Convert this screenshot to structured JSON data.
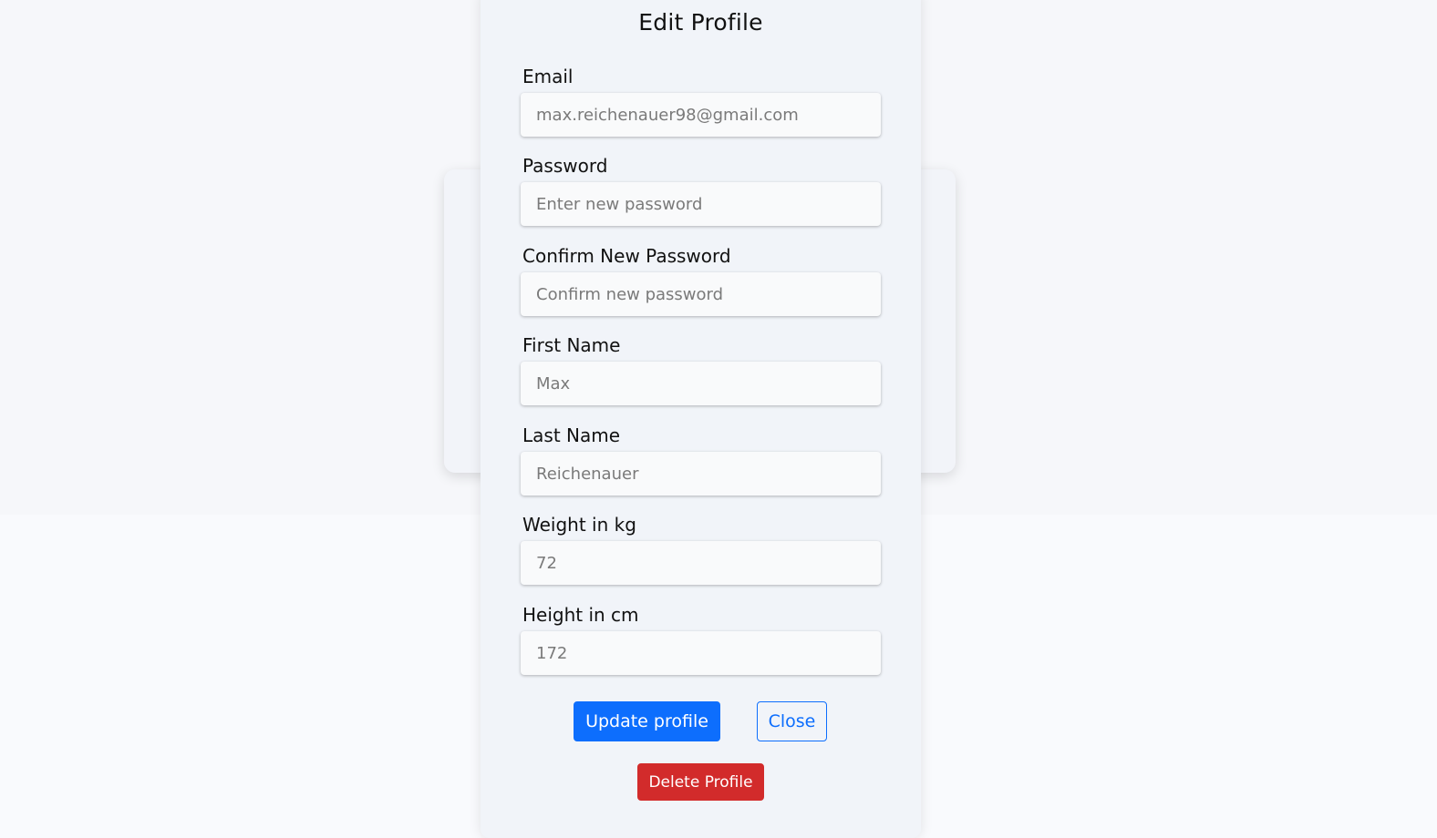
{
  "modal": {
    "title": "Edit Profile",
    "fields": [
      {
        "label": "Email",
        "value": "",
        "placeholder": "max.reichenauer98@gmail.com",
        "type": "email"
      },
      {
        "label": "Password",
        "value": "",
        "placeholder": "Enter new password",
        "type": "password"
      },
      {
        "label": "Confirm New Password",
        "value": "",
        "placeholder": "Confirm new password",
        "type": "password"
      },
      {
        "label": "First Name",
        "value": "",
        "placeholder": "Max",
        "type": "text"
      },
      {
        "label": "Last Name",
        "value": "",
        "placeholder": "Reichenauer",
        "type": "text"
      },
      {
        "label": "Weight in kg",
        "value": "",
        "placeholder": "72",
        "type": "number"
      },
      {
        "label": "Height in cm",
        "value": "",
        "placeholder": "172",
        "type": "number"
      }
    ],
    "buttons": {
      "update": "Update profile",
      "close": "Close",
      "delete": "Delete Profile"
    }
  },
  "colors": {
    "primary": "#0d6efd",
    "danger": "#d22b2b",
    "modal_bg": "#f1f4f9",
    "page_bg": "#f9fafd"
  }
}
